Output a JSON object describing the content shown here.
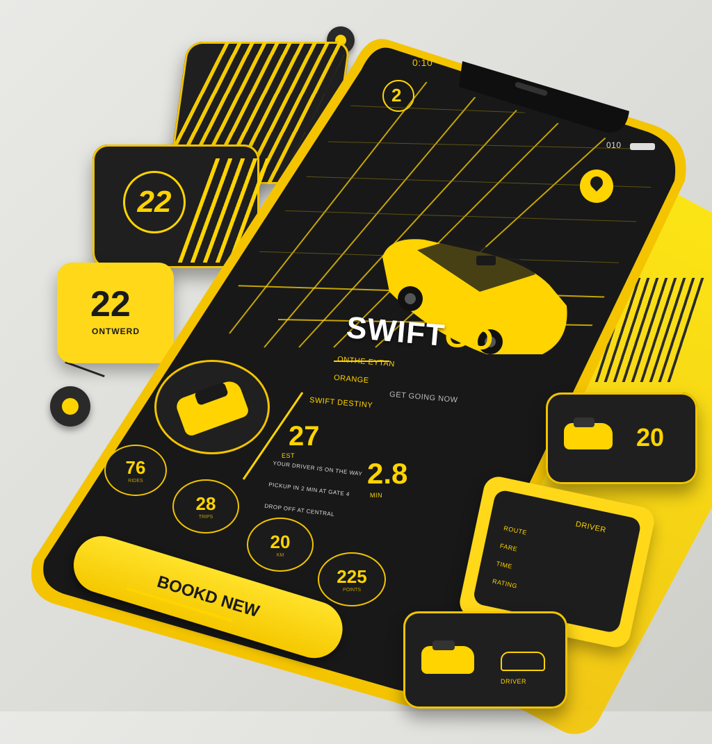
{
  "colors": {
    "accent": "#ffd400",
    "dark": "#1d1d1d",
    "background": "#e2e2de"
  },
  "status_bar": {
    "time": "0:10",
    "right": "010"
  },
  "app": {
    "brand_part1": "SWIFT",
    "brand_part2": "GO",
    "tagline": "ONTHE EYTAN",
    "sub_a": "ORANGE",
    "sub_b": "GET GOING NOW"
  },
  "map": {
    "top_badge": "2",
    "pin_icon": "location-pin-icon"
  },
  "ride_panel": {
    "label": "SWIFT DESTINY",
    "fare": "27",
    "fare_caption": "EST",
    "eta": "2.8",
    "eta_caption": "MIN",
    "details": [
      "YOUR DRIVER IS ON THE WAY",
      "PICKUP IN 2 MIN AT GATE 4",
      "DROP OFF AT CENTRAL"
    ]
  },
  "stats": [
    {
      "value": "76",
      "caption": "RIDES"
    },
    {
      "value": "28",
      "caption": "TRIPS"
    },
    {
      "value": "20",
      "caption": "KM"
    },
    {
      "value": "225",
      "caption": "POINTS"
    }
  ],
  "book_button": {
    "label": "BOOKD NEW"
  },
  "side_cards": {
    "badge_card": {
      "value": "22"
    },
    "yellow_card": {
      "value": "22",
      "caption": "ONTWERD"
    },
    "right_card_1": {
      "value": "20"
    },
    "right_card_2": {
      "title": "DRIVER",
      "lines": [
        "ROUTE",
        "FARE",
        "TIME",
        "RATING"
      ]
    },
    "right_card_3": {
      "caption": "DRIVER"
    }
  }
}
